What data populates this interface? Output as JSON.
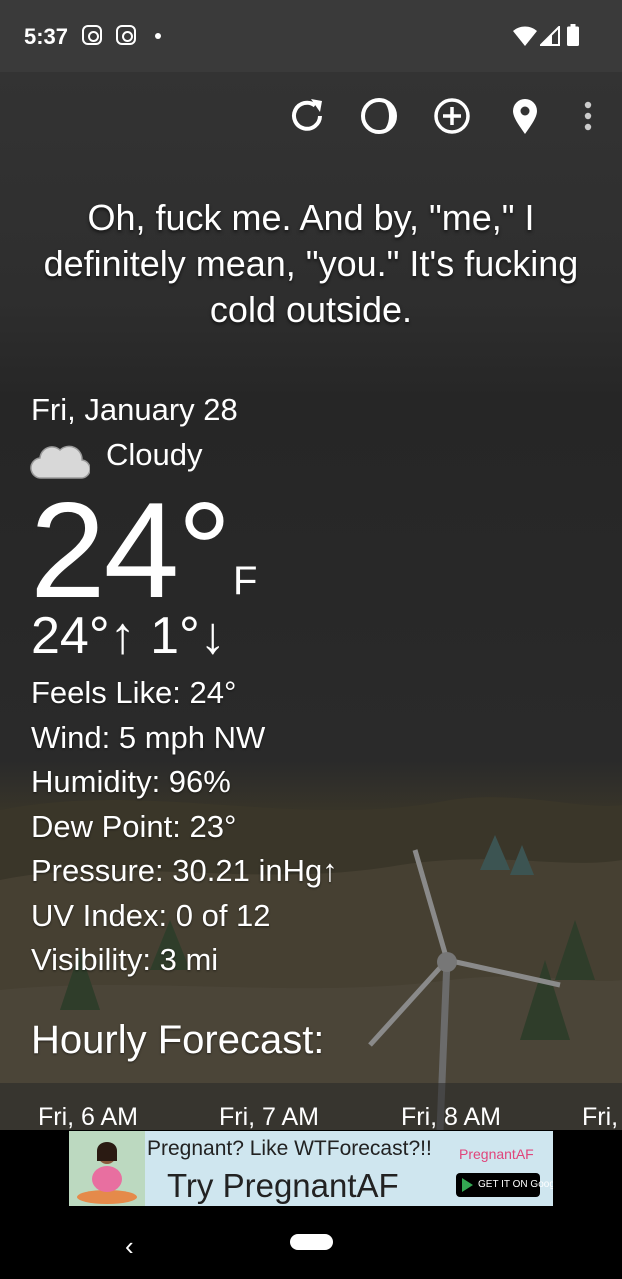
{
  "status_bar": {
    "time": "5:37",
    "icons": [
      "instagram-icon",
      "instagram-icon",
      "notification-dot-icon",
      "wifi-icon",
      "signal-icon",
      "battery-icon"
    ]
  },
  "toolbar": {
    "icons": [
      "refresh-icon",
      "theme-icon",
      "add-location-icon",
      "location-pin-icon",
      "more-options-icon"
    ]
  },
  "headline": "Oh, fuck me. And by, \"me,\" I definitely mean, \"you.\" It's fucking cold outside.",
  "current": {
    "date": "Fri, January 28",
    "condition": "Cloudy",
    "condition_icon": "cloud-icon",
    "temperature": "24°",
    "unit": "F",
    "high_low": "24°↑ 1°↓"
  },
  "details": [
    "Feels Like:  24°",
    "Wind:  5 mph NW",
    "Humidity:  96%",
    "Dew Point:  23°",
    "Pressure:  30.21 inHg↑",
    "UV Index:  0 of 12",
    "Visibility:  3 mi"
  ],
  "hourly": {
    "title": "Hourly Forecast:",
    "hours": [
      "Fri, 6 AM",
      "Fri, 7 AM",
      "Fri, 8 AM",
      "Fri,"
    ]
  },
  "ad": {
    "line1": "Pregnant? Like WTForecast?!!",
    "brand": "PregnantAF",
    "line2": "Try PregnantAF",
    "store_badge": "GET IT ON Google Play"
  },
  "colors": {
    "text": "#ffffff",
    "status_bar": "#3a3a3a",
    "background": "#2a2a2a",
    "ad_background": "#cfe6ef",
    "ad_brand": "#e0457b"
  }
}
